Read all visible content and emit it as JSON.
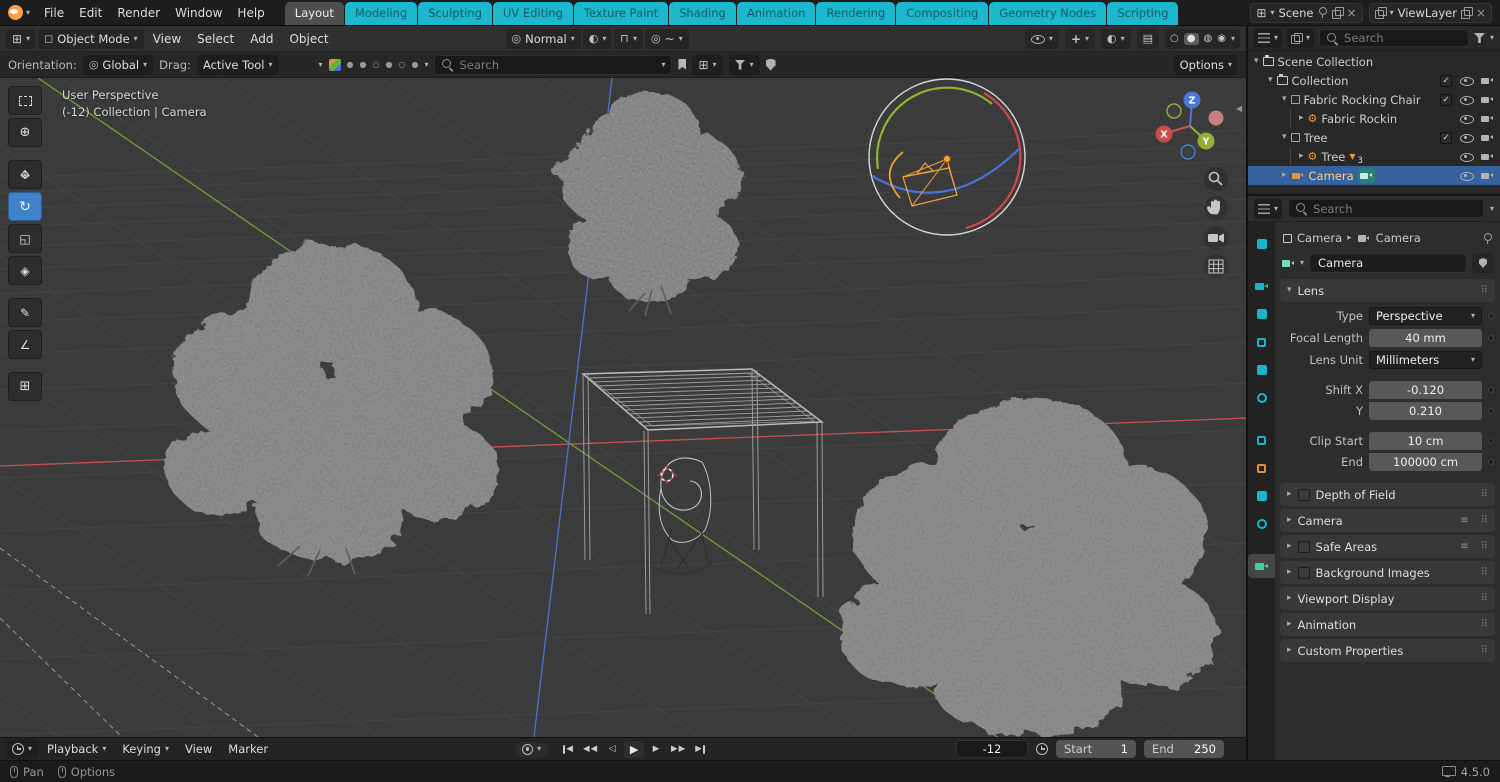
{
  "topbar": {
    "menus": [
      "File",
      "Edit",
      "Render",
      "Window",
      "Help"
    ],
    "tabs": [
      "Layout",
      "Modeling",
      "Sculpting",
      "UV Editing",
      "Texture Paint",
      "Shading",
      "Animation",
      "Rendering",
      "Compositing",
      "Geometry Nodes",
      "Scripting"
    ],
    "active_tab": "Layout",
    "scene_label": "Scene",
    "view_layer_label": "ViewLayer"
  },
  "viewport_header": {
    "mode": "Object Mode",
    "menus": [
      "View",
      "Select",
      "Add",
      "Object"
    ],
    "orientation": "Normal"
  },
  "tool_settings": {
    "orientation_label": "Orientation:",
    "orientation_value": "Global",
    "drag_label": "Drag:",
    "drag_value": "Active Tool",
    "search_placeholder": "Search",
    "options_label": "Options"
  },
  "viewport": {
    "overlay_line1": "User Perspective",
    "overlay_line2": "(-12) Collection | Camera",
    "nav_axes": {
      "x": "X",
      "y": "Y",
      "z": "Z"
    }
  },
  "outliner": {
    "search_placeholder": "Search",
    "rows": [
      {
        "label": "Scene Collection"
      },
      {
        "label": "Collection"
      },
      {
        "label": "Fabric Rocking Chair"
      },
      {
        "label": "Fabric Rockin"
      },
      {
        "label": "Tree"
      },
      {
        "label": "Tree",
        "count": "3"
      },
      {
        "label": "Camera"
      }
    ]
  },
  "properties": {
    "search_placeholder": "Search",
    "breadcrumb": {
      "level1": "Camera",
      "level2": "Camera"
    },
    "data_name": "Camera",
    "lens": {
      "title": "Lens",
      "rows": {
        "type_label": "Type",
        "type_value": "Perspective",
        "focal_label": "Focal Length",
        "focal_value": "40 mm",
        "unit_label": "Lens Unit",
        "unit_value": "Millimeters",
        "shiftx_label": "Shift X",
        "shiftx_value": "-0.120",
        "shifty_label": "Y",
        "shifty_value": "0.210",
        "clipstart_label": "Clip Start",
        "clipstart_value": "10 cm",
        "clipend_label": "End",
        "clipend_value": "100000 cm"
      }
    },
    "sections": [
      {
        "label": "Depth of Field"
      },
      {
        "label": "Camera"
      },
      {
        "label": "Safe Areas"
      },
      {
        "label": "Background Images"
      },
      {
        "label": "Viewport Display"
      },
      {
        "label": "Animation"
      },
      {
        "label": "Custom Properties"
      }
    ]
  },
  "timeline": {
    "menus": [
      "Playback",
      "Keying",
      "View",
      "Marker"
    ],
    "current_frame": "-12",
    "start_label": "Start",
    "start_value": "1",
    "end_label": "End",
    "end_value": "250"
  },
  "statusbar": {
    "pan_label": "Pan",
    "options_label": "Options",
    "version": "4.5.0"
  },
  "colors": {
    "accent_cyan": "#1cb8cd",
    "selection_blue": "#36629e",
    "active_object_text": "#ffcd8a",
    "axis_red": "#c5514f",
    "axis_green": "#71a13c",
    "axis_blue": "#4f74c8",
    "camera_orange": "#f2a33c",
    "tool_active_blue": "#3e83c9"
  }
}
